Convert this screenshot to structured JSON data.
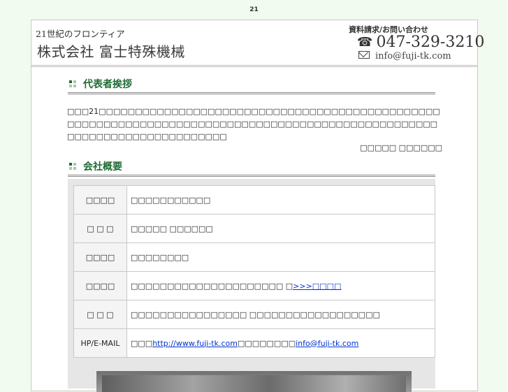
{
  "page": {
    "number": "21"
  },
  "header": {
    "company_sub": "21世紀のフロンティア",
    "company_name": "株式会社 富士特殊機械",
    "contact_label": "資料請求/お問い合わせ",
    "phone": "047-329-3210",
    "email": "info@fuji-tk.com"
  },
  "greeting": {
    "title": "代表者挨拶",
    "body": "□□□21□□□□□□□□□□□□□□□□□□□□□□□□□□□□□□□□□□□□□□□□□□□□□□□□□□□□□□□□□□□□□□□□□□□□□□□□□□□□□□□□□□□□□□□□□□□□□□□□□□□□□□□□□□□□□□□□□□□□□□□□",
    "signature": "□□□□□ □□□□□□"
  },
  "overview": {
    "title": "会社概要",
    "rows": [
      {
        "label": "□□□□",
        "value": "□□□□□□□□□□□"
      },
      {
        "label": "□ □ □",
        "value": "□□□□□ □□□□□□"
      },
      {
        "label": "□□□□",
        "value": "□□□□□□□□"
      },
      {
        "label": "□□□□",
        "value": "□□□□□□□□□□□□□□□□□□□□□ □",
        "link": ">>>□□□□"
      },
      {
        "label": "□ □ □",
        "value": "□□□□□□□□□□□□□□□□ □□□□□□□□□□□□□□□□□□"
      },
      {
        "label": "HP/E-MAIL",
        "prefix": "□□□",
        "url": "http://www.fuji-tk.com",
        "mid": "□□□□□□□□",
        "email": "info@fuji-tk.com"
      }
    ]
  },
  "colors": {
    "background": "#f2fbef",
    "accent": "#1f6b33",
    "link": "#0033cc"
  }
}
